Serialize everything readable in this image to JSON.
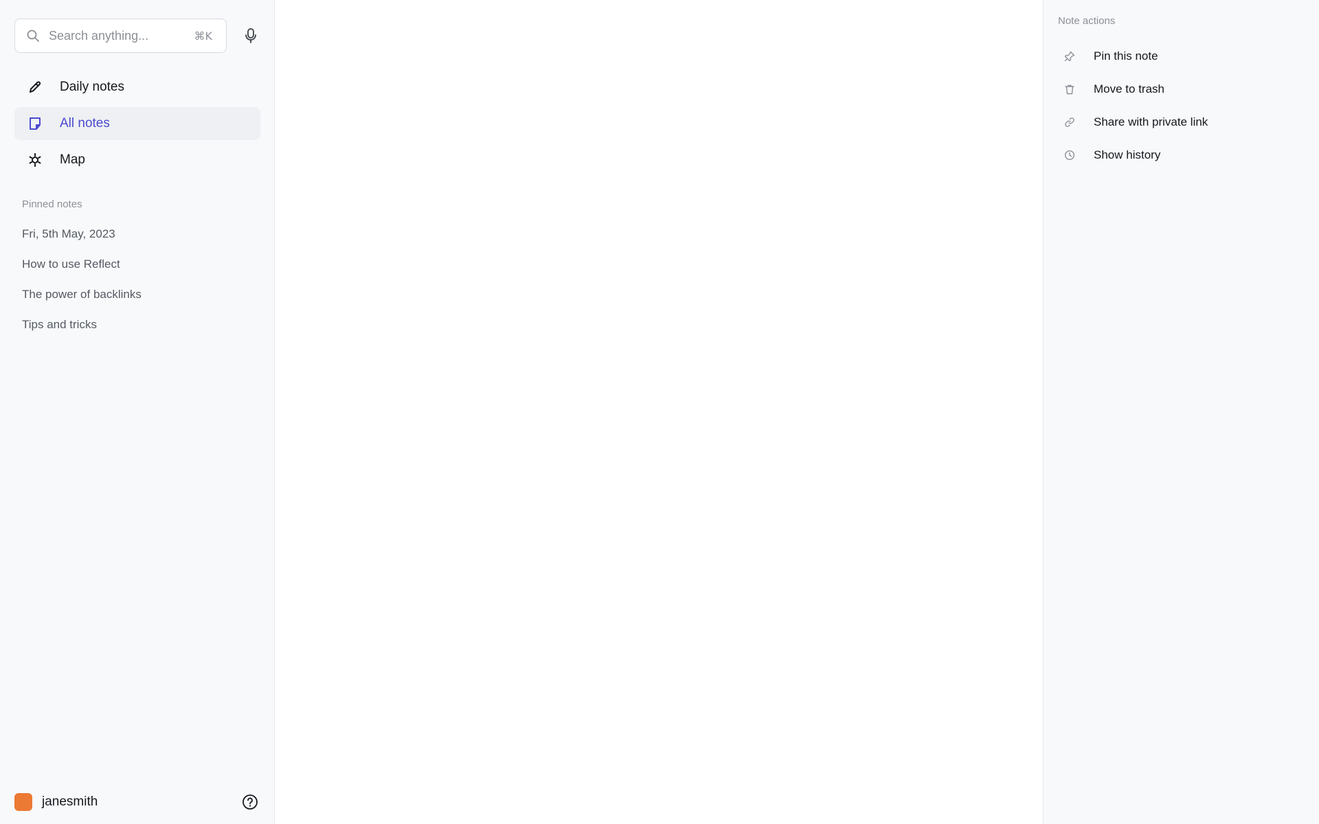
{
  "search": {
    "placeholder": "Search anything...",
    "shortcut": "⌘K"
  },
  "nav": {
    "items": [
      {
        "label": "Daily notes",
        "icon": "pencil-icon"
      },
      {
        "label": "All notes",
        "icon": "note-icon",
        "active": true
      },
      {
        "label": "Map",
        "icon": "map-icon"
      }
    ]
  },
  "pinned": {
    "header": "Pinned notes",
    "items": [
      "Fri, 5th May, 2023",
      "How to use Reflect",
      "The power of backlinks",
      "Tips and tricks"
    ]
  },
  "user": {
    "name": "janesmith",
    "avatar_color": "#ec7a34"
  },
  "note_actions": {
    "header": "Note actions",
    "items": [
      {
        "label": "Pin this note",
        "icon": "pin-icon"
      },
      {
        "label": "Move to trash",
        "icon": "trash-icon"
      },
      {
        "label": "Share with private link",
        "icon": "link-icon"
      },
      {
        "label": "Show history",
        "icon": "clock-icon"
      }
    ]
  },
  "colors": {
    "accent": "#4b4ad0",
    "sidebar_bg": "#f8f9fb"
  }
}
